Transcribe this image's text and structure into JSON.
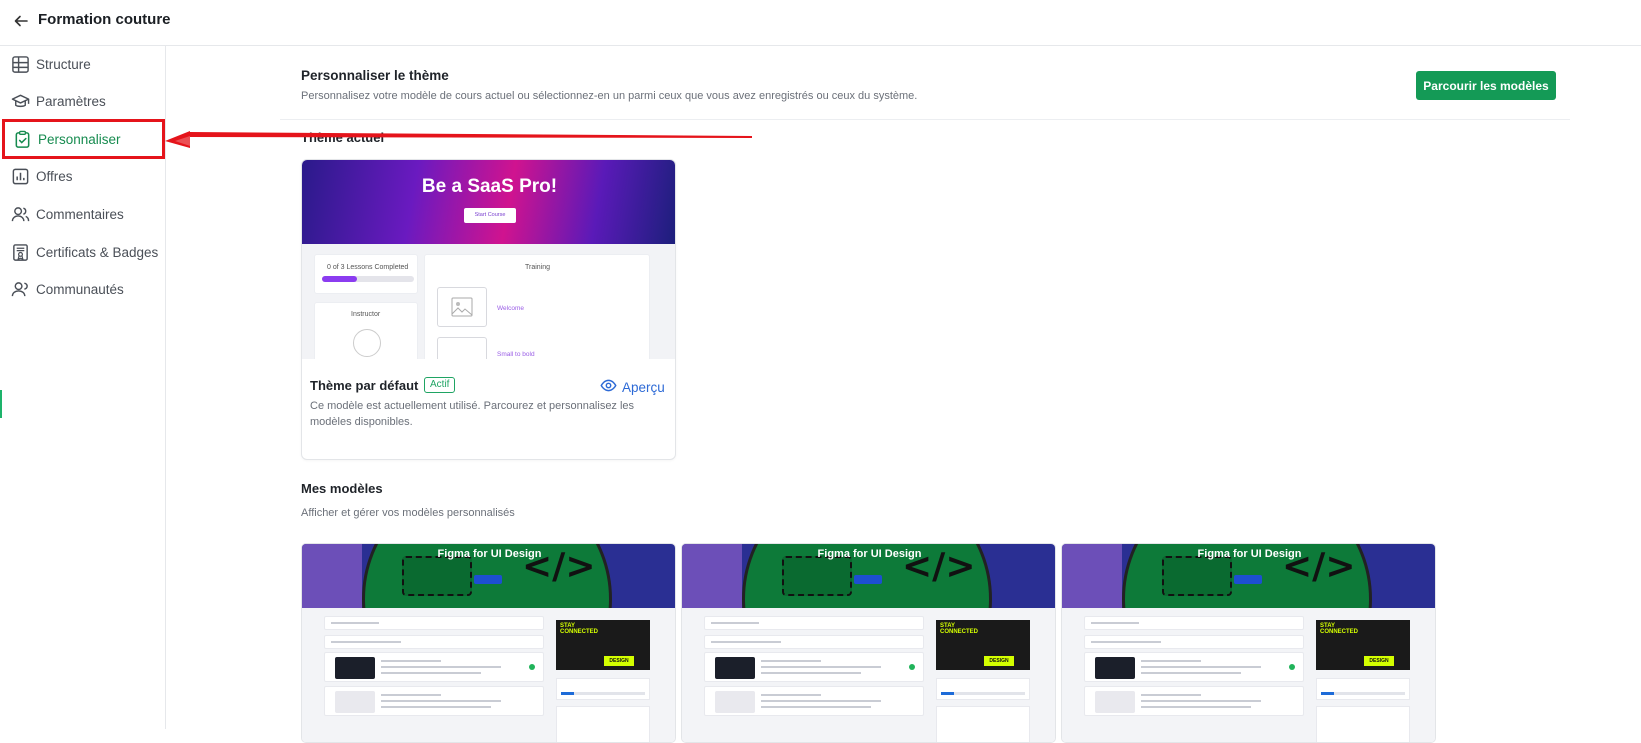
{
  "topbar": {
    "back_icon": "arrow-left-icon",
    "title": "Formation couture"
  },
  "sidebar": {
    "items": [
      {
        "label": "Structure",
        "icon": "table-icon"
      },
      {
        "label": "Paramètres",
        "icon": "graduation-cap-icon"
      },
      {
        "label": "Personnaliser",
        "icon": "clipboard-check-icon",
        "active": true
      },
      {
        "label": "Offres",
        "icon": "bar-chart-icon"
      },
      {
        "label": "Commentaires",
        "icon": "users-icon"
      },
      {
        "label": "Certificats & Badges",
        "icon": "certificate-icon"
      },
      {
        "label": "Communautés",
        "icon": "community-icon"
      }
    ]
  },
  "header": {
    "title": "Personnaliser le thème",
    "subtitle": "Personnalisez votre modèle de cours actuel ou sélectionnez-en un parmi ceux que vous avez enregistrés ou ceux du système.",
    "browse_button": "Parcourir les modèles"
  },
  "current_theme": {
    "section_label": "Thème actuel",
    "preview_banner_title": "Be a SaaS Pro!",
    "preview_banner_button": "Start Course",
    "preview_progress_text": "0 of 3 Lessons Completed",
    "preview_progress": 0.38,
    "preview_instructor": "Instructor",
    "preview_training": "Training",
    "preview_link_1": "Welcome",
    "preview_link_2": "Small to bold",
    "name": "Thème par défaut",
    "badge": "Actif",
    "preview_link": "Aperçu",
    "description": "Ce modèle est actuellement utilisé. Parcourez et personnalisez les modèles disponibles."
  },
  "my_templates": {
    "title": "Mes modèles",
    "subtitle": "Afficher et gérer vos modèles personnalisés",
    "cards": [
      {
        "banner_title": "Figma for UI Design",
        "poster_text": "STAY CONNECTED",
        "poster_badge": "DESIGN",
        "progress": 0.16
      },
      {
        "banner_title": "Figma for UI Design",
        "poster_text": "STAY CONNECTED",
        "poster_badge": "DESIGN",
        "progress": 0.16
      },
      {
        "banner_title": "Figma for UI Design",
        "poster_text": "STAY CONNECTED",
        "poster_badge": "DESIGN",
        "progress": 0.16
      }
    ]
  },
  "colors": {
    "accent_green": "#149a56",
    "annotation_red": "#e5141b",
    "link_blue": "#2d6ad6"
  }
}
